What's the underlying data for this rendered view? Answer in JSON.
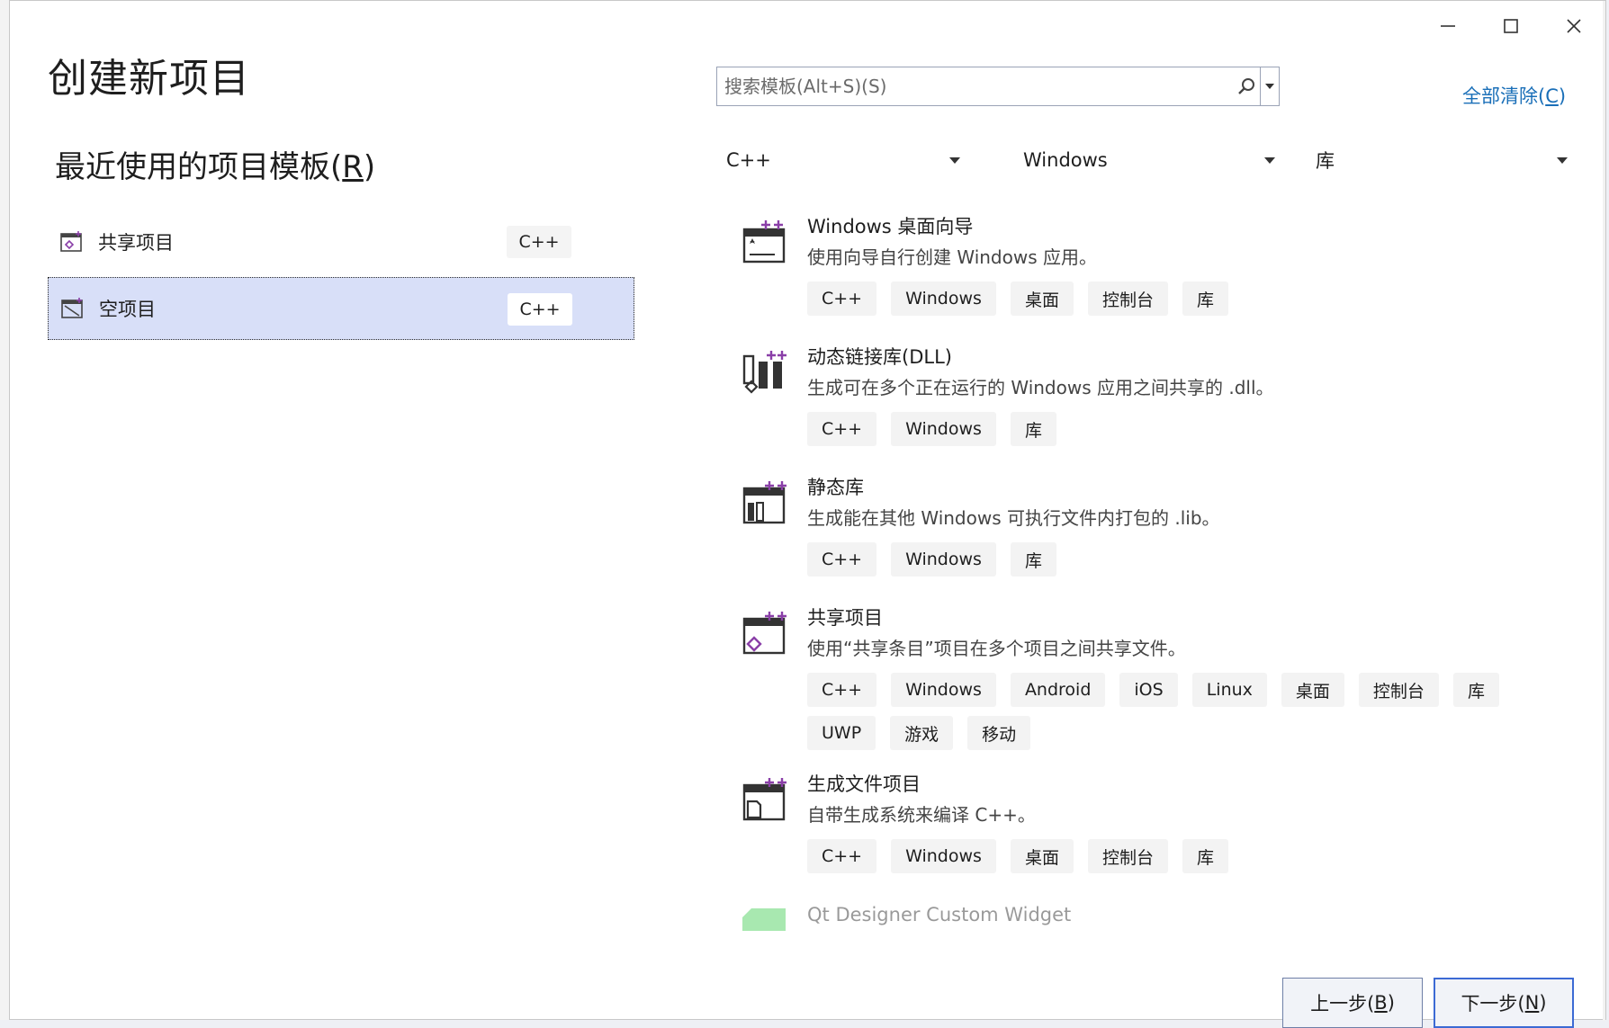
{
  "window": {
    "title": "创建新项目",
    "controls": {
      "minimize": "minimize-icon",
      "maximize": "maximize-icon",
      "close": "close-icon"
    }
  },
  "recent": {
    "section_title_main": "最近使用的项目模板(",
    "section_title_key": "R",
    "section_title_end": ")",
    "items": [
      {
        "name": "共享项目",
        "lang": "C++",
        "icon": "shared-project-icon",
        "selected": false
      },
      {
        "name": "空项目",
        "lang": "C++",
        "icon": "empty-project-icon",
        "selected": true
      }
    ]
  },
  "search": {
    "placeholder": "搜索模板(Alt+S)(S)"
  },
  "clear_all": {
    "main": "全部清除(",
    "key": "C",
    "end": ")"
  },
  "filters": {
    "language": "C++",
    "platform": "Windows",
    "project_type": "库"
  },
  "templates": [
    {
      "name": "Windows 桌面向导",
      "desc": "使用向导自行创建 Windows 应用。",
      "tags": [
        "C++",
        "Windows",
        "桌面",
        "控制台",
        "库"
      ],
      "icon": "desktop-wizard-icon"
    },
    {
      "name": "动态链接库(DLL)",
      "desc": "生成可在多个正在运行的 Windows 应用之间共享的 .dll。",
      "tags": [
        "C++",
        "Windows",
        "库"
      ],
      "icon": "dll-icon"
    },
    {
      "name": "静态库",
      "desc": "生成能在其他 Windows 可执行文件内打包的 .lib。",
      "tags": [
        "C++",
        "Windows",
        "库"
      ],
      "icon": "static-lib-icon"
    },
    {
      "name": "共享项目",
      "desc": "使用“共享条目”项目在多个项目之间共享文件。",
      "tags": [
        "C++",
        "Windows",
        "Android",
        "iOS",
        "Linux",
        "桌面",
        "控制台",
        "库",
        "UWP",
        "游戏",
        "移动"
      ],
      "icon": "shared-project-icon"
    },
    {
      "name": "生成文件项目",
      "desc": "自带生成系统来编译 C++。",
      "tags": [
        "C++",
        "Windows",
        "桌面",
        "控制台",
        "库"
      ],
      "icon": "makefile-project-icon"
    },
    {
      "name": "Qt Designer Custom Widget",
      "desc": "",
      "tags": [],
      "icon": "qt-icon"
    }
  ],
  "buttons": {
    "back_main": "上一步(",
    "back_key": "B",
    "back_end": ")",
    "next_main": "下一步(",
    "next_key": "N",
    "next_end": ")"
  }
}
